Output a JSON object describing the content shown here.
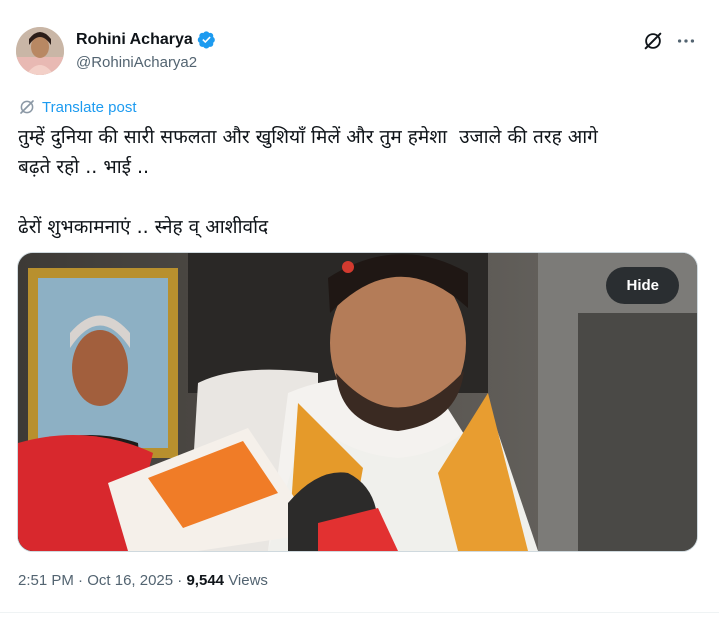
{
  "header": {
    "name": "Rohini Acharya",
    "handle": "@RohiniAcharya2"
  },
  "translate": {
    "label": "Translate post"
  },
  "tweet": {
    "line1": "तुम्हें दुनिया की सारी सफलता और खुशियाँ मिलें और तुम हमेशा  उजाले की तरह आगे",
    "line2": "बढ़ते रहो .. भाई ..",
    "line3": "ढेरों शुभकामनाएं .. स्नेह व् आशीर्वाद"
  },
  "media": {
    "hide_label": "Hide"
  },
  "meta": {
    "time": "2:51 PM",
    "date": "Oct 16, 2025",
    "views_count": "9,544",
    "views_label": "Views",
    "sep": "·"
  },
  "colors": {
    "accent": "#1d9bf0",
    "text": "#0f1419",
    "muted": "#536471"
  },
  "icons": [
    "verified-badge-icon",
    "grok-icon",
    "more-icon",
    "translate-icon"
  ]
}
